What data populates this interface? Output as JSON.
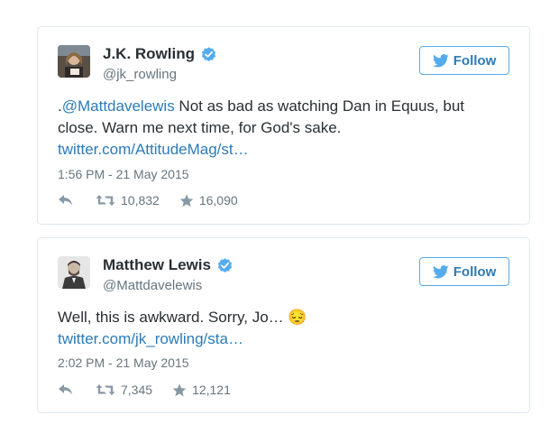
{
  "tweets": [
    {
      "name": "J.K. Rowling",
      "handle": "@jk_rowling",
      "follow_label": "Follow",
      "text_prefix": ".",
      "mention": "@Mattdavelewis",
      "text": " Not as bad as watching Dan in Equus, but close. Warn me next time, for God's sake.",
      "link": "twitter.com/AttitudeMag/st…",
      "timestamp": "1:56 PM - 21 May 2015",
      "retweets": "10,832",
      "favorites": "16,090",
      "icons": [
        "reply-icon",
        "retweet-icon",
        "star-icon",
        "verified-icon",
        "bird-icon"
      ]
    },
    {
      "name": "Matthew Lewis",
      "handle": "@Mattdavelewis",
      "follow_label": "Follow",
      "text": "Well, this is awkward. Sorry, Jo… ",
      "emoji": "😔",
      "link": "twitter.com/jk_rowling/sta…",
      "timestamp": "2:02 PM - 21 May 2015",
      "retweets": "7,345",
      "favorites": "12,121",
      "icons": [
        "reply-icon",
        "retweet-icon",
        "star-icon",
        "verified-icon",
        "bird-icon"
      ]
    }
  ],
  "colors": {
    "link": "#2b7bb9",
    "verified": "#55acee",
    "border": "#e1e8ed",
    "muted": "#66757f",
    "text": "#292f33"
  }
}
